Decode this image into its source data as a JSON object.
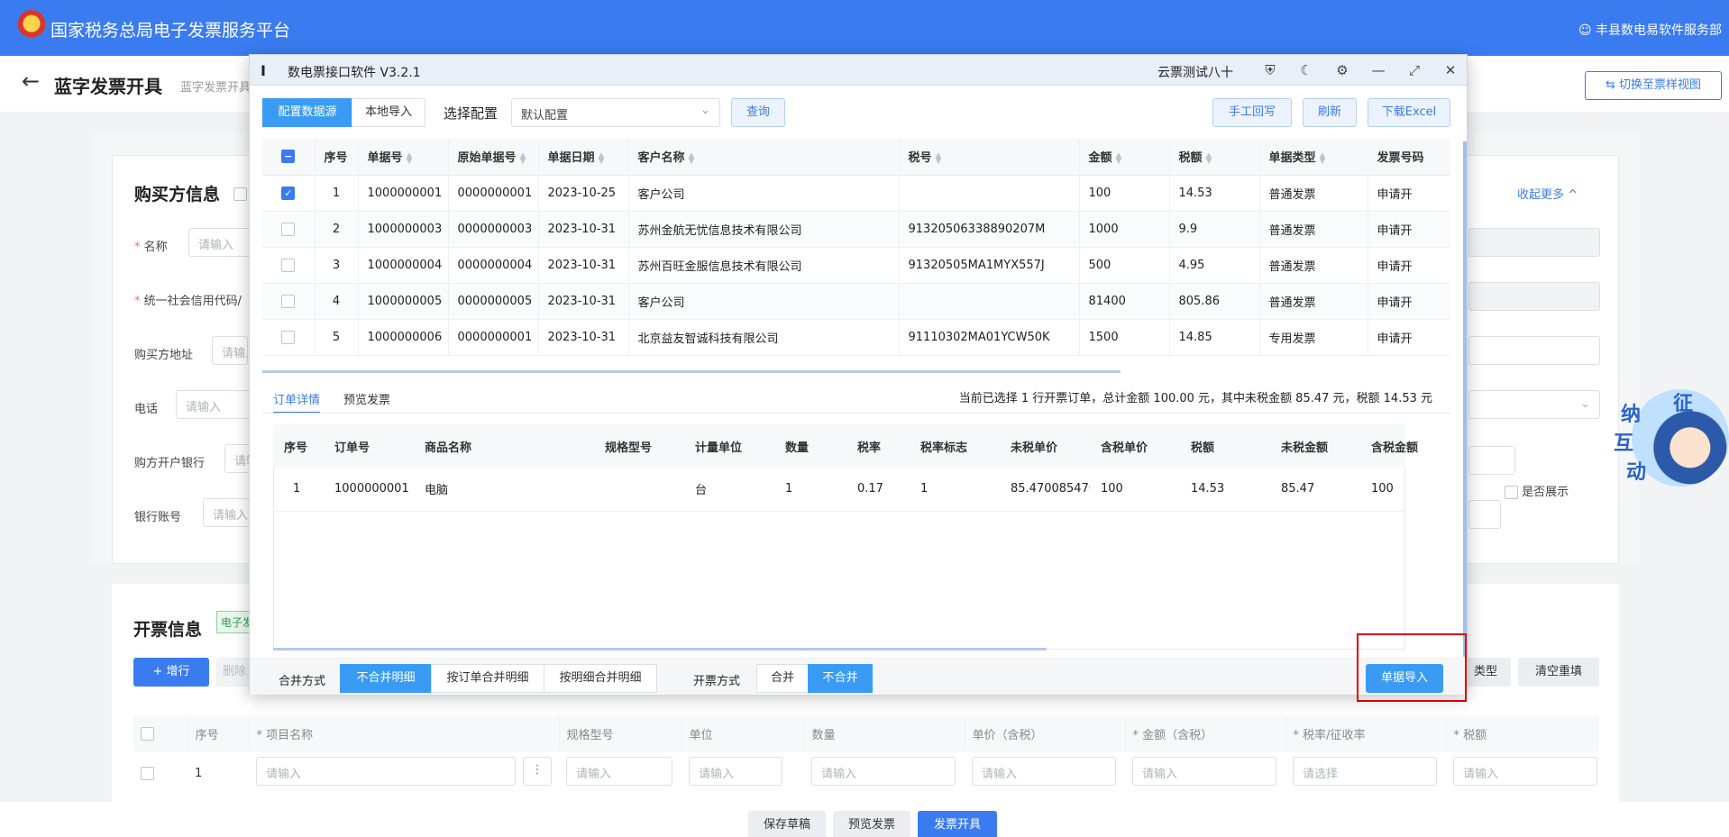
{
  "app": {
    "title": "国家税务总局电子发票服务平台",
    "user": "丰县数电易软件服务部"
  },
  "page": {
    "back_icon": "arrow-left-icon",
    "title": "蓝字发票开具",
    "breadcrumb": "蓝字发票开具",
    "switch_label": "切换至票样视图"
  },
  "buyer": {
    "title": "购买方信息",
    "collapse": "收起更多 ^",
    "name_label": "名称",
    "credit_label": "统一社会信用代码/",
    "addr_label": "购买方地址",
    "phone_label": "电话",
    "bank_label": "购方开户银行",
    "account_label": "银行账号",
    "placeholder": "请输入",
    "show_label": "是否展示"
  },
  "invoice": {
    "title": "开票信息",
    "tag": "电子发",
    "add_row": "+ 增行",
    "delete": "删除",
    "type_btn": "类型",
    "clear_btn": "清空重填",
    "columns": [
      "",
      "序号",
      "* 项目名称",
      "规格型号",
      "单位",
      "数量",
      "单价（含税）",
      "* 金额（含税）",
      "* 税率/征收率",
      "* 税额"
    ],
    "row": {
      "index": "1",
      "placeholder": "请输入",
      "select_placeholder": "请选择"
    }
  },
  "footer": {
    "save": "保存草稿",
    "preview": "预览发票",
    "issue": "发票开具"
  },
  "dialog": {
    "logo": "Ⅰ",
    "title": "数电票接口软件 V3.2.1",
    "account": "云票测试八十",
    "icons": [
      "shield-icon",
      "moon-icon",
      "bug-icon",
      "minimize-icon",
      "maximize-icon",
      "close-icon"
    ],
    "tab_config": "配置数据源",
    "tab_local": "本地导入",
    "config_label": "选择配置",
    "config_value": "默认配置",
    "query": "查询",
    "manual_writeback": "手工回写",
    "refresh": "刷新",
    "download_excel": "下载Excel",
    "grid_columns": [
      "",
      "序号",
      "单据号",
      "原始单据号",
      "单据日期",
      "客户名称",
      "税号",
      "金额",
      "税额",
      "单据类型",
      "发票号码"
    ],
    "grid_rows": [
      {
        "checked": true,
        "idx": "1",
        "doc": "1000000001",
        "orig": "0000000001",
        "date": "2023-10-25",
        "customer": "客户公司",
        "tax_id": "",
        "amount": "100",
        "tax": "14.53",
        "type": "普通发票",
        "status": "申请开"
      },
      {
        "checked": false,
        "idx": "2",
        "doc": "1000000003",
        "orig": "0000000003",
        "date": "2023-10-31",
        "customer": "苏州金航无忧信息技术有限公司",
        "tax_id": "91320506338890207M",
        "amount": "1000",
        "tax": "9.9",
        "type": "普通发票",
        "status": "申请开"
      },
      {
        "checked": false,
        "idx": "3",
        "doc": "1000000004",
        "orig": "0000000004",
        "date": "2023-10-31",
        "customer": "苏州百旺金服信息技术有限公司",
        "tax_id": "91320505MA1MYX557J",
        "amount": "500",
        "tax": "4.95",
        "type": "普通发票",
        "status": "申请开"
      },
      {
        "checked": false,
        "idx": "4",
        "doc": "1000000005",
        "orig": "0000000005",
        "date": "2023-10-31",
        "customer": "客户公司",
        "tax_id": "",
        "amount": "81400",
        "tax": "805.86",
        "type": "普通发票",
        "status": "申请开"
      },
      {
        "checked": false,
        "idx": "5",
        "doc": "1000000006",
        "orig": "0000000001",
        "date": "2023-10-31",
        "customer": "北京益友智诚科技有限公司",
        "tax_id": "91110302MA01YCW50K",
        "amount": "1500",
        "tax": "14.85",
        "type": "专用发票",
        "status": "申请开"
      }
    ],
    "detail_tab": "订单详情",
    "preview_tab": "预览发票",
    "summary": "当前已选择 1 行开票订单，总计金额 100.00 元，其中未税金额 85.47 元，税额 14.53 元",
    "detail_columns": [
      "序号",
      "订单号",
      "商品名称",
      "规格型号",
      "计量单位",
      "数量",
      "税率",
      "税率标志",
      "未税单价",
      "含税单价",
      "税额",
      "未税金额",
      "含税金额"
    ],
    "detail_rows": [
      {
        "idx": "1",
        "order": "1000000001",
        "name": "电脑",
        "spec": "",
        "unit": "台",
        "qty": "1",
        "rate": "0.17",
        "flag": "1",
        "unit_price": "85.470085470",
        "tax_price": "100",
        "tax": "14.53",
        "net": "85.47",
        "gross": "100"
      }
    ],
    "merge_label": "合并方式",
    "merge_options": [
      "不合并明细",
      "按订单合并明细",
      "按明细合并明细"
    ],
    "issue_label": "开票方式",
    "issue_options": [
      "合并",
      "不合并"
    ],
    "import_btn": "单据导入"
  },
  "mascot": {
    "text": [
      "征",
      "纳",
      "互",
      "动"
    ]
  },
  "colors": {
    "primary": "#3a7bf0",
    "highlight": "#e00000",
    "accent": "#f0a020"
  }
}
